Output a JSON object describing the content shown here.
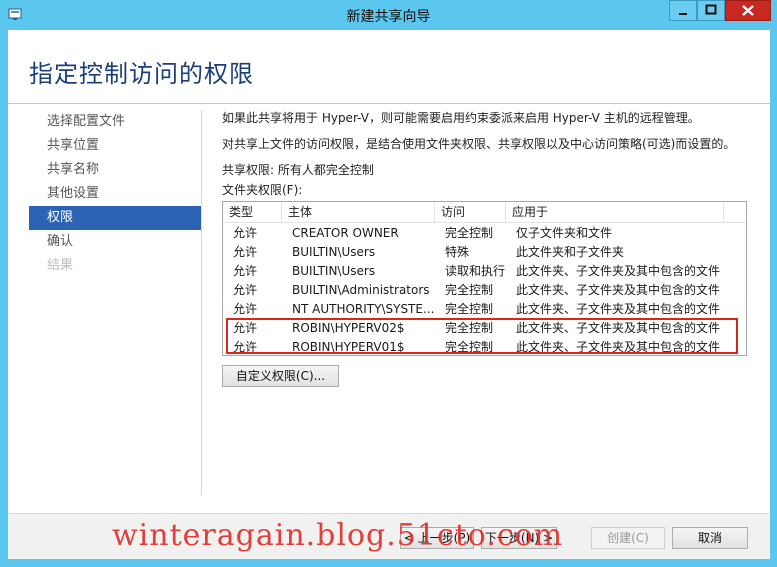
{
  "window": {
    "title": "新建共享向导",
    "app_icon": "share-wizard-icon",
    "controls": {
      "minimize": "minimize-icon",
      "maximize": "maximize-icon",
      "close": "close-icon"
    }
  },
  "page_title": "指定控制访问的权限",
  "nav": {
    "items": [
      {
        "label": "选择配置文件",
        "state": "normal"
      },
      {
        "label": "共享位置",
        "state": "normal"
      },
      {
        "label": "共享名称",
        "state": "normal"
      },
      {
        "label": "其他设置",
        "state": "normal"
      },
      {
        "label": "权限",
        "state": "active"
      },
      {
        "label": "确认",
        "state": "normal"
      },
      {
        "label": "结果",
        "state": "disabled"
      }
    ]
  },
  "main": {
    "hyperv_note": "如果此共享将用于 Hyper-V，则可能需要启用约束委派来启用 Hyper-V 主机的远程管理。",
    "access_note": "对共享上文件的访问权限，是结合使用文件夹权限、共享权限以及中心访问策略(可选)而设置的。",
    "share_perm": "共享权限: 所有人都完全控制",
    "folder_perm_label": "文件夹权限(F):",
    "columns": [
      "类型",
      "主体",
      "访问",
      "应用于"
    ],
    "rows": [
      [
        "允许",
        "CREATOR OWNER",
        "完全控制",
        "仅子文件夹和文件"
      ],
      [
        "允许",
        "BUILTIN\\Users",
        "特殊",
        "此文件夹和子文件夹"
      ],
      [
        "允许",
        "BUILTIN\\Users",
        "读取和执行",
        "此文件夹、子文件夹及其中包含的文件"
      ],
      [
        "允许",
        "BUILTIN\\Administrators",
        "完全控制",
        "此文件夹、子文件夹及其中包含的文件"
      ],
      [
        "允许",
        "NT AUTHORITY\\SYSTE...",
        "完全控制",
        "此文件夹、子文件夹及其中包含的文件"
      ],
      [
        "允许",
        "ROBIN\\HYPERV02$",
        "完全控制",
        "此文件夹、子文件夹及其中包含的文件"
      ],
      [
        "允许",
        "ROBIN\\HYPERV01$",
        "完全控制",
        "此文件夹、子文件夹及其中包含的文件"
      ]
    ],
    "custom_perm_button": "自定义权限(C)..."
  },
  "footer": {
    "prev": "< 上一步(P)",
    "next": "下一步(N) >",
    "create": "创建(C)",
    "cancel": "取消"
  },
  "watermark": "winteragain.blog.51cto.com",
  "colors": {
    "accent": "#2c63b5",
    "title_bar": "#5bc6ee",
    "highlight": "#d8261e",
    "watermark": "#e0302a"
  }
}
